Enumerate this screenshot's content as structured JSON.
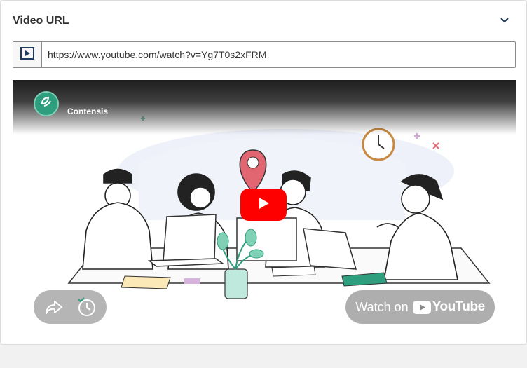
{
  "panel": {
    "title": "Video URL",
    "collapse_icon": "chevron-down-icon"
  },
  "url_field": {
    "prefix_icon": "video-play-icon",
    "value": "https://www.youtube.com/watch?v=Yg7T0s2xFRM"
  },
  "video": {
    "channel_name": "Contensis",
    "watch_label": "Watch on",
    "youtube_brand": "YouTube",
    "colors": {
      "play_red": "#ff0000",
      "brand_green": "#2e9e7e"
    }
  }
}
